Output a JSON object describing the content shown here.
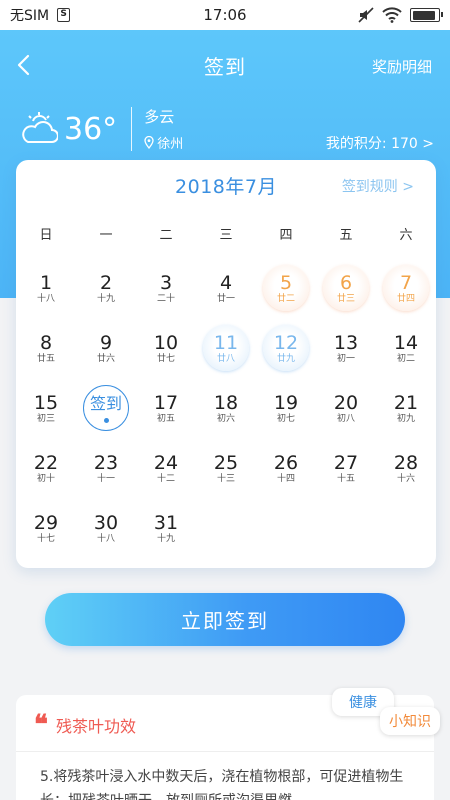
{
  "status": {
    "carrier": "无SIM",
    "time": "17:06",
    "battery_level": 0.9
  },
  "nav": {
    "title": "签到",
    "right_link": "奖励明细"
  },
  "weather": {
    "temperature": "36°",
    "condition": "多云",
    "city": "徐州"
  },
  "points_text": "我的积分: 170 >",
  "calendar": {
    "month_title": "2018年7月",
    "rules_link": "签到规则 >",
    "weekdays": [
      "日",
      "一",
      "二",
      "三",
      "四",
      "五",
      "六"
    ],
    "today_label": "签到",
    "weeks": [
      [
        {
          "d": "1",
          "l": "十八"
        },
        {
          "d": "2",
          "l": "十九"
        },
        {
          "d": "3",
          "l": "二十"
        },
        {
          "d": "4",
          "l": "廿一"
        },
        {
          "d": "5",
          "l": "廿二",
          "s": "orange"
        },
        {
          "d": "6",
          "l": "廿三",
          "s": "orange"
        },
        {
          "d": "7",
          "l": "廿四",
          "s": "orange"
        }
      ],
      [
        {
          "d": "8",
          "l": "廿五"
        },
        {
          "d": "9",
          "l": "廿六"
        },
        {
          "d": "10",
          "l": "廿七"
        },
        {
          "d": "11",
          "l": "廿八",
          "s": "blue"
        },
        {
          "d": "12",
          "l": "廿九",
          "s": "blue"
        },
        {
          "d": "13",
          "l": "初一"
        },
        {
          "d": "14",
          "l": "初二"
        }
      ],
      [
        {
          "d": "15",
          "l": "初三"
        },
        {
          "d": "",
          "l": "",
          "s": "today"
        },
        {
          "d": "17",
          "l": "初五"
        },
        {
          "d": "18",
          "l": "初六"
        },
        {
          "d": "19",
          "l": "初七"
        },
        {
          "d": "20",
          "l": "初八"
        },
        {
          "d": "21",
          "l": "初九"
        }
      ],
      [
        {
          "d": "22",
          "l": "初十"
        },
        {
          "d": "23",
          "l": "十一"
        },
        {
          "d": "24",
          "l": "十二"
        },
        {
          "d": "25",
          "l": "十三"
        },
        {
          "d": "26",
          "l": "十四"
        },
        {
          "d": "27",
          "l": "十五"
        },
        {
          "d": "28",
          "l": "十六"
        }
      ],
      [
        {
          "d": "29",
          "l": "十七"
        },
        {
          "d": "30",
          "l": "十八"
        },
        {
          "d": "31",
          "l": "十九"
        }
      ]
    ]
  },
  "signin_button": "立即签到",
  "tip": {
    "tag_health": "健康",
    "tag_tip": "小知识",
    "title": "残茶叶功效",
    "body": "5.将残茶叶浸入水中数天后，浇在植物根部，可促进植物生长；把残茶叶晒干，放到厕所或沟渠里燃"
  },
  "colors": {
    "accent": "#3a8fe0",
    "header": "#5fc9fb",
    "orange": "#f2a44a",
    "red": "#ef5a52"
  }
}
